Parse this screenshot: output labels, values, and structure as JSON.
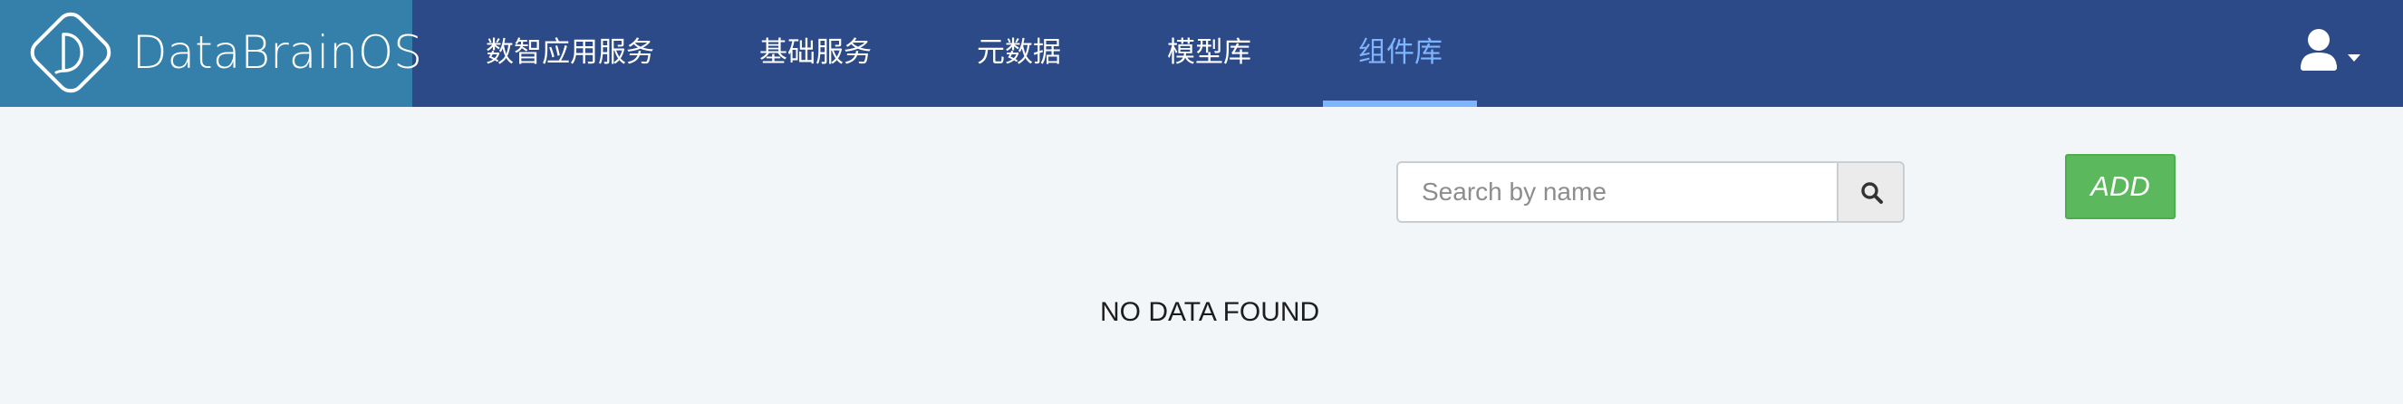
{
  "brand": {
    "logo_icon": "databrain-logo-icon",
    "name": "DataBrainOS"
  },
  "nav": {
    "items": [
      {
        "label": "数智应用服务",
        "active": false
      },
      {
        "label": "基础服务",
        "active": false
      },
      {
        "label": "元数据",
        "active": false
      },
      {
        "label": "模型库",
        "active": false
      },
      {
        "label": "组件库",
        "active": true
      }
    ]
  },
  "user_menu": {
    "icon": "user-icon",
    "caret_icon": "caret-down-icon"
  },
  "search": {
    "placeholder": "Search by name",
    "value": "",
    "button_icon": "search-icon"
  },
  "toolbar": {
    "add_label": "ADD"
  },
  "results": {
    "empty_message": "NO DATA FOUND"
  },
  "colors": {
    "header_bg": "#2c4a88",
    "brand_bg": "#3580ab",
    "active_nav": "#7fb5ff",
    "page_bg": "#f2f6f9",
    "add_button": "#5cb85c"
  }
}
